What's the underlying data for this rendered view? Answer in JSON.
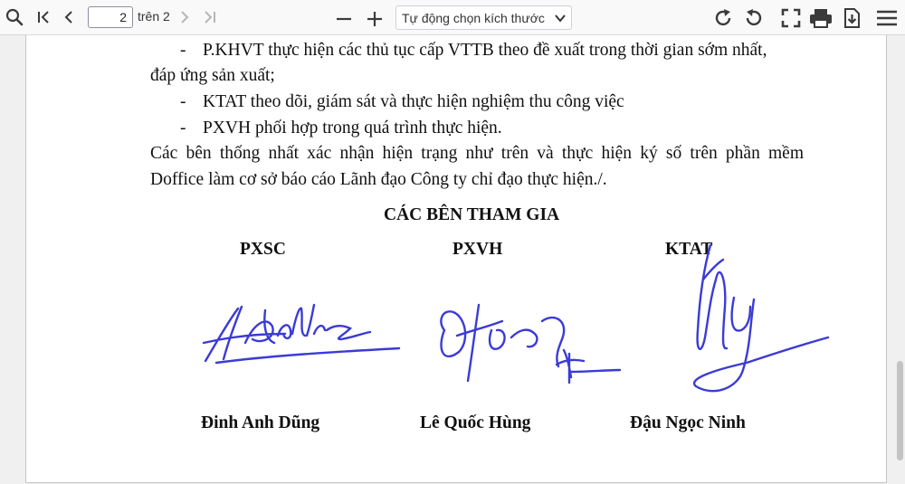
{
  "toolbar": {
    "current_page": "2",
    "page_of": "trên 2",
    "zoom": "Tự động chọn kích thước",
    "icons": [
      "search-icon",
      "first-page-icon",
      "previous-page-icon",
      "next-page-icon",
      "last-page-icon",
      "zoom-out-icon",
      "zoom-in-icon",
      "rotate-clockwise-icon",
      "rotate-counterclockwise-icon",
      "fullscreen-icon",
      "print-icon",
      "download-icon",
      "menu-icon"
    ]
  },
  "document": {
    "item1_l1": "P.KHVT thực hiện các thủ tục cấp VTTB theo đề xuất trong thời gian sớm nhất,",
    "item1_l2": "đáp ứng sản xuất;",
    "item2": "KTAT theo dõi, giám sát và thực hiện nghiệm thu công việc",
    "item3": "PXVH phối hợp trong quá trình thực hiện.",
    "para_l1": "Các bên thống nhất xác nhận hiện trạng như trên và thực hiện ký số trên phần mềm",
    "para_l2": "Doffice làm cơ sở báo cáo Lãnh đạo Công ty chỉ đạo thực hiện./.",
    "parties_title": "CÁC BÊN THAM GIA",
    "dash": "-",
    "parties": [
      {
        "unit": "PXSC",
        "name": "Đinh Anh Dũng"
      },
      {
        "unit": "PXVH",
        "name": "Lê Quốc Hùng"
      },
      {
        "unit": "KTAT",
        "name": "Đậu Ngọc Ninh"
      }
    ]
  },
  "colors": {
    "ink": "#3b3bd6",
    "text": "#111111",
    "toolbar_bg": "#f9f9fa"
  }
}
